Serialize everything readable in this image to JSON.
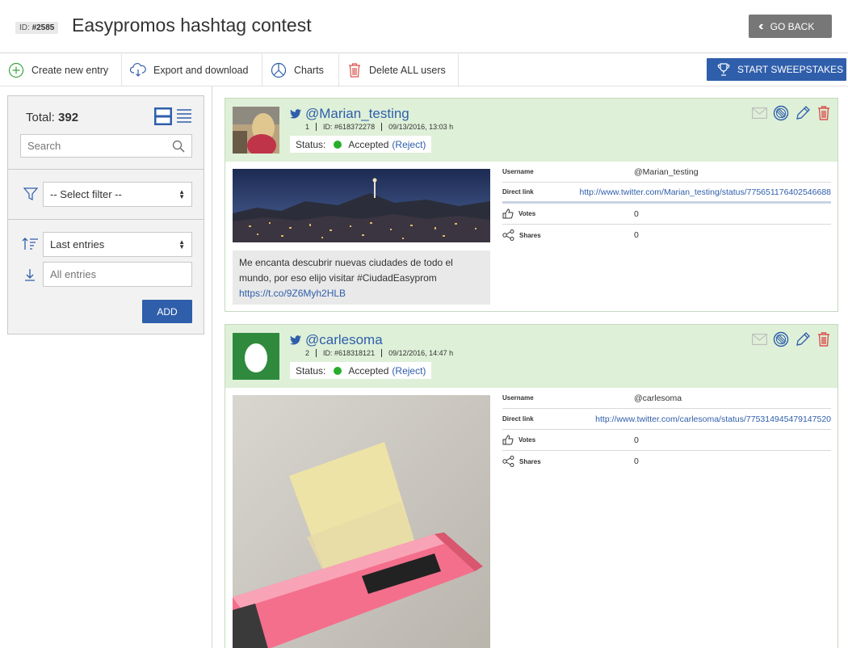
{
  "header": {
    "id_label": "ID:",
    "id_value": "#2585",
    "title": "Easypromos hashtag contest",
    "go_back": "GO BACK"
  },
  "toolbar": {
    "create": "Create new entry",
    "export": "Export and download",
    "charts": "Charts",
    "delete": "Delete ALL users",
    "sweepstakes": "START SWEEPSTAKES"
  },
  "sidebar": {
    "total_label": "Total:",
    "total_value": "392",
    "search_placeholder": "Search",
    "filter_select": "-- Select filter --",
    "sort_select": "Last entries",
    "entries_placeholder": "All entries",
    "add_button": "ADD"
  },
  "colors": {
    "accent": "#2f5eab",
    "entry_header": "#def0d8",
    "accepted": "#27ae2b",
    "delete": "#d9534f"
  },
  "entries": [
    {
      "handle": "@Marian_testing",
      "number": "1",
      "id": "ID: #618372278",
      "date": "09/13/2016, 13:03 h",
      "status_label": "Status:",
      "status": "Accepted",
      "reject": "(Reject)",
      "text": "Me encanta descubrir nuevas ciudades de todo el mundo, por eso elijo visitar #CiudadEasyprom",
      "text_link": "https://t.co/9Z6Myh2HLB",
      "details": {
        "username_label": "Username",
        "username": "@Marian_testing",
        "link_label": "Direct link",
        "link": "http://www.twitter.com/Marian_testing/status/775651176402546688",
        "votes_label": "Votes",
        "votes": "0",
        "shares_label": "Shares",
        "shares": "0"
      }
    },
    {
      "handle": "@carlesoma",
      "number": "2",
      "id": "ID: #618318121",
      "date": "09/12/2016, 14:47 h",
      "status_label": "Status:",
      "status": "Accepted",
      "reject": "(Reject)",
      "details": {
        "username_label": "Username",
        "username": "@carlesoma",
        "link_label": "Direct link",
        "link": "http://www.twitter.com/carlesoma/status/775314945479147520",
        "votes_label": "Votes",
        "votes": "0",
        "shares_label": "Shares",
        "shares": "0"
      }
    }
  ]
}
